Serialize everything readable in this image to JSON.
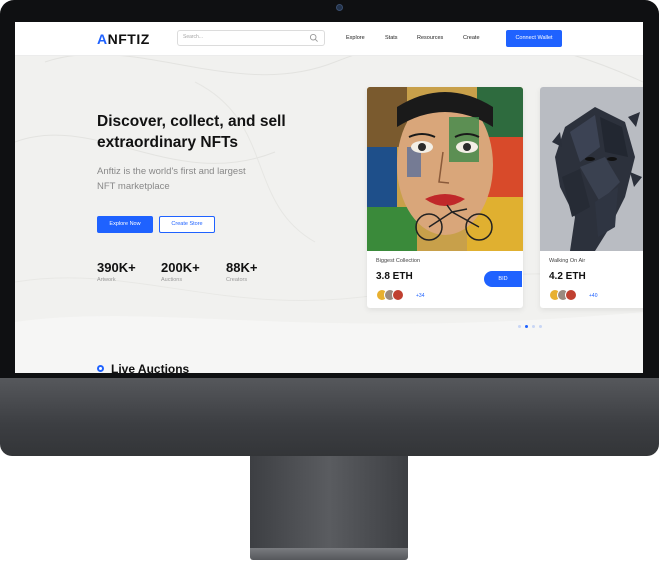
{
  "brand": {
    "logo_text_accent": "A",
    "logo_text_rest": "NFTIZ",
    "accent_color": "#1f62ff"
  },
  "search": {
    "placeholder": "Search..."
  },
  "nav": {
    "items": [
      "Explore",
      "Stats",
      "Resources",
      "Create"
    ],
    "connect_label": "Connect Wallet"
  },
  "hero": {
    "title": "Discover, collect, and sell extraordinary NFTs",
    "subtitle": "Anftiz is the world's first and largest NFT marketplace",
    "explore_label": "Explore Now",
    "create_store_label": "Create Store"
  },
  "stats": [
    {
      "value": "390K+",
      "label": "Artwork"
    },
    {
      "value": "200K+",
      "label": "Auctions"
    },
    {
      "value": "88K+",
      "label": "Creators"
    }
  ],
  "cards": [
    {
      "title": "Biggest Collection",
      "price": "3.8 ETH",
      "bid_label": "BID",
      "avatar_count": "+34",
      "image": "portrait-mosaic-art"
    },
    {
      "title": "Walking On Air",
      "price": "4.2 ETH",
      "avatar_count": "+40",
      "image": "fragmented-head-sculpture"
    }
  ],
  "carousel": {
    "total": 4,
    "active": 1
  },
  "live_auctions": {
    "title": "Live Auctions"
  }
}
